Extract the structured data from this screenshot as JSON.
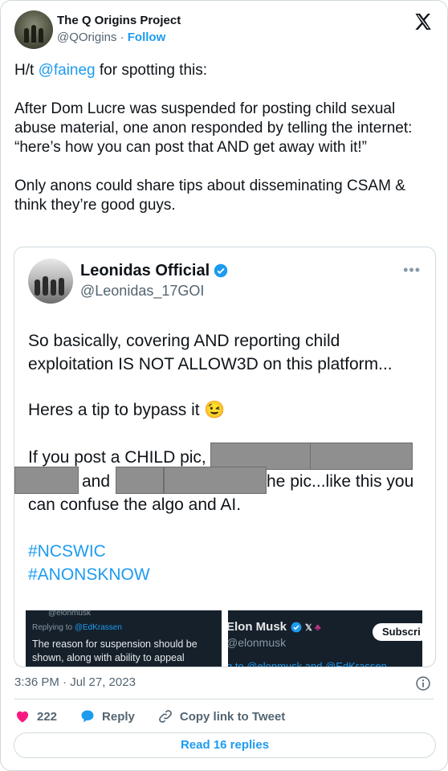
{
  "author": {
    "display_name": "The Q Origins Project",
    "handle": "@QOrigins",
    "separator": "·",
    "follow_label": "Follow"
  },
  "tweet": {
    "lead": "H/t ",
    "mention": "@faineg",
    "after_mention": " for spotting this:",
    "body": "After Dom Lucre was suspended for posting child sexual abuse material, one anon responded by telling the internet: “here’s how you can post that AND get away with it!”\n\nOnly anons could share tips about disseminating CSAM & think they’re good guys."
  },
  "media": {
    "name": "Leonidas Official",
    "handle": "@Leonidas_17GOI",
    "more": "•••",
    "line1": "So basically, covering AND reporting child",
    "line2": "exploitation IS NOT ALLOW3D on this platform...",
    "line3": "Heres a tip to bypass it 😉",
    "line4": "If you post a CHILD pic,",
    "line5a": "and",
    "line5b": "he pic...like this you",
    "line6": "can confuse the algo and AI.",
    "hashtag1": "#NCSWIC",
    "hashtag2": "#ANONSKNOW",
    "sub_left": {
      "handle": "@elonmusk",
      "replying_prefix": "Replying to ",
      "replying_mention": "@EdKrassen",
      "text1": "The reason for suspension should be",
      "text2": "shown, along with ability to appeal"
    },
    "sub_right": {
      "name": "Elon Musk",
      "handle": "@elonmusk",
      "subscribe": "Subscri",
      "reply_line": "g to @elonmusk and @EdKrassen"
    }
  },
  "footer": {
    "timestamp": "3:36 PM · Jul 27, 2023",
    "likes": "222",
    "reply_label": "Reply",
    "copy_label": "Copy link to Tweet",
    "read_label": "Read 16 replies"
  },
  "colors": {
    "accent": "#1d9bf0",
    "heart": "#f91880",
    "text": "#0f1419",
    "muted": "#536471"
  }
}
